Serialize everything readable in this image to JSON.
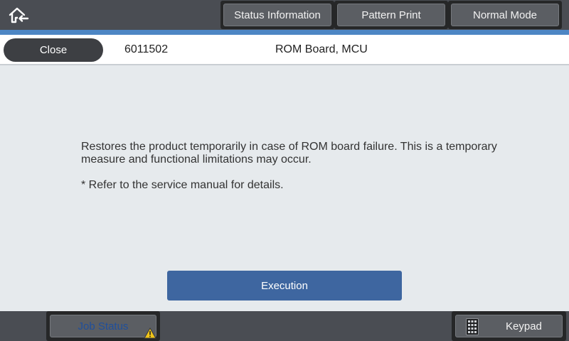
{
  "topbar": {
    "home_icon": "home-back-icon",
    "buttons": [
      "Status Information",
      "Pattern Print",
      "Normal Mode"
    ]
  },
  "header": {
    "close_label": "Close",
    "code": "6011502",
    "title": "ROM Board, MCU"
  },
  "main": {
    "description": "Restores the product temporarily in case of ROM board failure. This is a temporary measure and functional limitations may occur.",
    "note": "* Refer to the service manual for details.",
    "execute_label": "Execution"
  },
  "bottombar": {
    "job_status_label": "Job Status",
    "job_status_icon": "warning-icon",
    "keypad_label": "Keypad",
    "keypad_icon": "keypad-icon"
  },
  "colors": {
    "accent_blue": "#4d86c4",
    "execute_button": "#3e66a0",
    "warning": "#f0c419"
  }
}
